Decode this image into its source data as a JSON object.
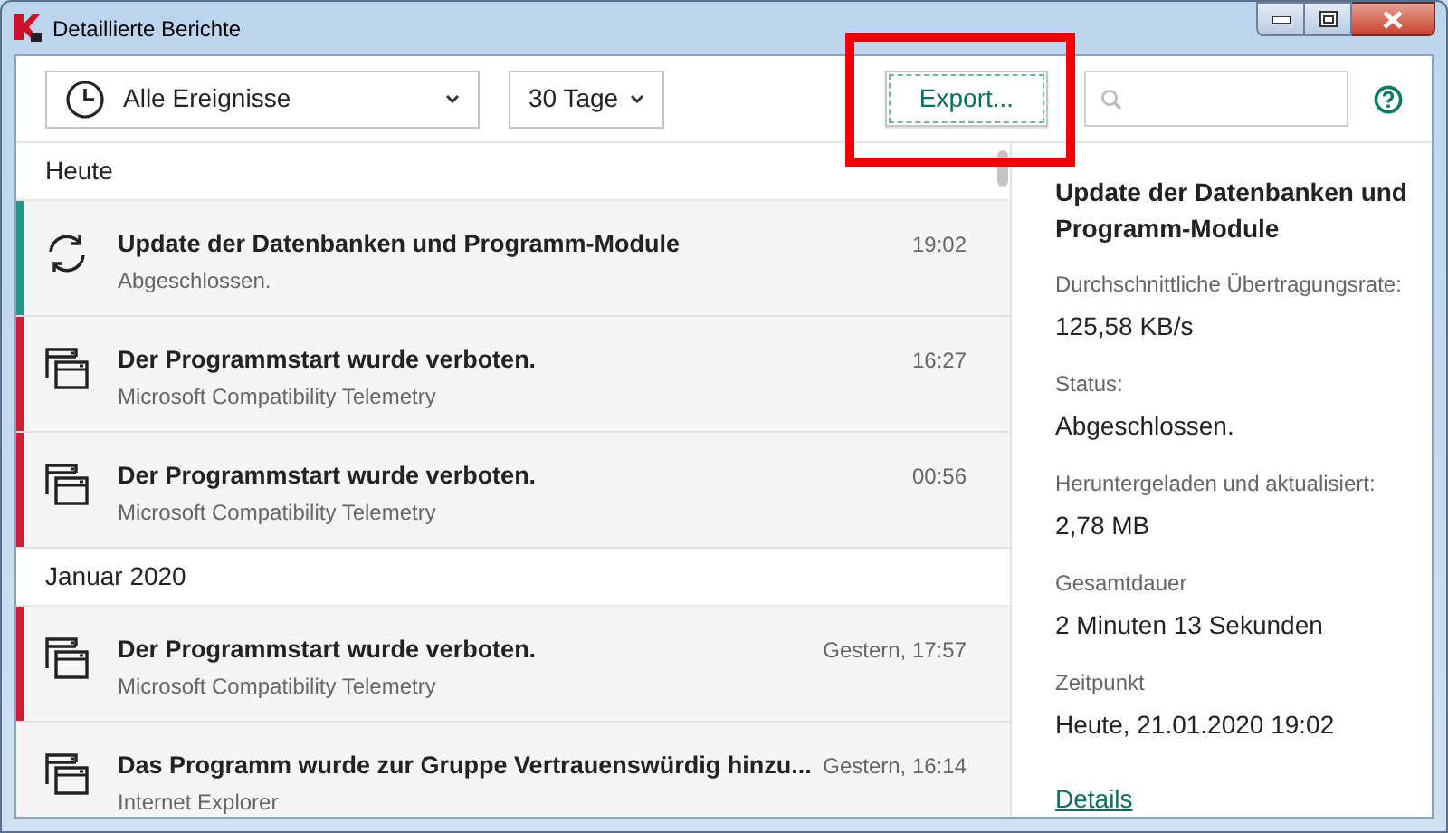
{
  "window": {
    "title": "Detaillierte Berichte"
  },
  "toolbar": {
    "event_filter": "Alle Ereignisse",
    "period_filter": "30 Tage",
    "export_button": {
      "label": "Export...",
      "highlighted": true
    }
  },
  "groups": [
    {
      "title": "Heute",
      "events": [
        {
          "kind": "update",
          "title": "Update der Datenbanken und Programm-Module",
          "subtitle": "Abgeschlossen.",
          "time": "19:02",
          "color": "#1a9a84"
        },
        {
          "kind": "app",
          "title": "Der Programmstart wurde verboten.",
          "subtitle": "Microsoft Compatibility Telemetry",
          "time": "16:27",
          "color": "#c8202f"
        },
        {
          "kind": "app",
          "title": "Der Programmstart wurde verboten.",
          "subtitle": "Microsoft Compatibility Telemetry",
          "time": "00:56",
          "color": "#c8202f"
        }
      ]
    },
    {
      "title": "Januar 2020",
      "events": [
        {
          "kind": "app",
          "title": "Der Programmstart wurde verboten.",
          "subtitle": "Microsoft Compatibility Telemetry",
          "time": "Gestern, 17:57",
          "color": "#c8202f"
        },
        {
          "kind": "app",
          "title": "Das Programm wurde zur Gruppe Vertrauenswürdig hinzu...",
          "subtitle": "Internet Explorer",
          "time": "Gestern, 16:14"
        }
      ]
    }
  ],
  "details": {
    "title": "Update der Datenbanken und Programm-Module",
    "fields": [
      {
        "label": "Durchschnittliche Übertragungsrate:",
        "value": "125,58 KB/s"
      },
      {
        "label": "Status:",
        "value": "Abgeschlossen."
      },
      {
        "label": "Heruntergeladen und aktualisiert:",
        "value": "2,78 MB"
      },
      {
        "label": "Gesamtdauer",
        "value": "2 Minuten 13 Sekunden"
      },
      {
        "label": "Zeitpunkt",
        "value": "Heute, 21.01.2020 19:02"
      }
    ],
    "link": "Details"
  }
}
